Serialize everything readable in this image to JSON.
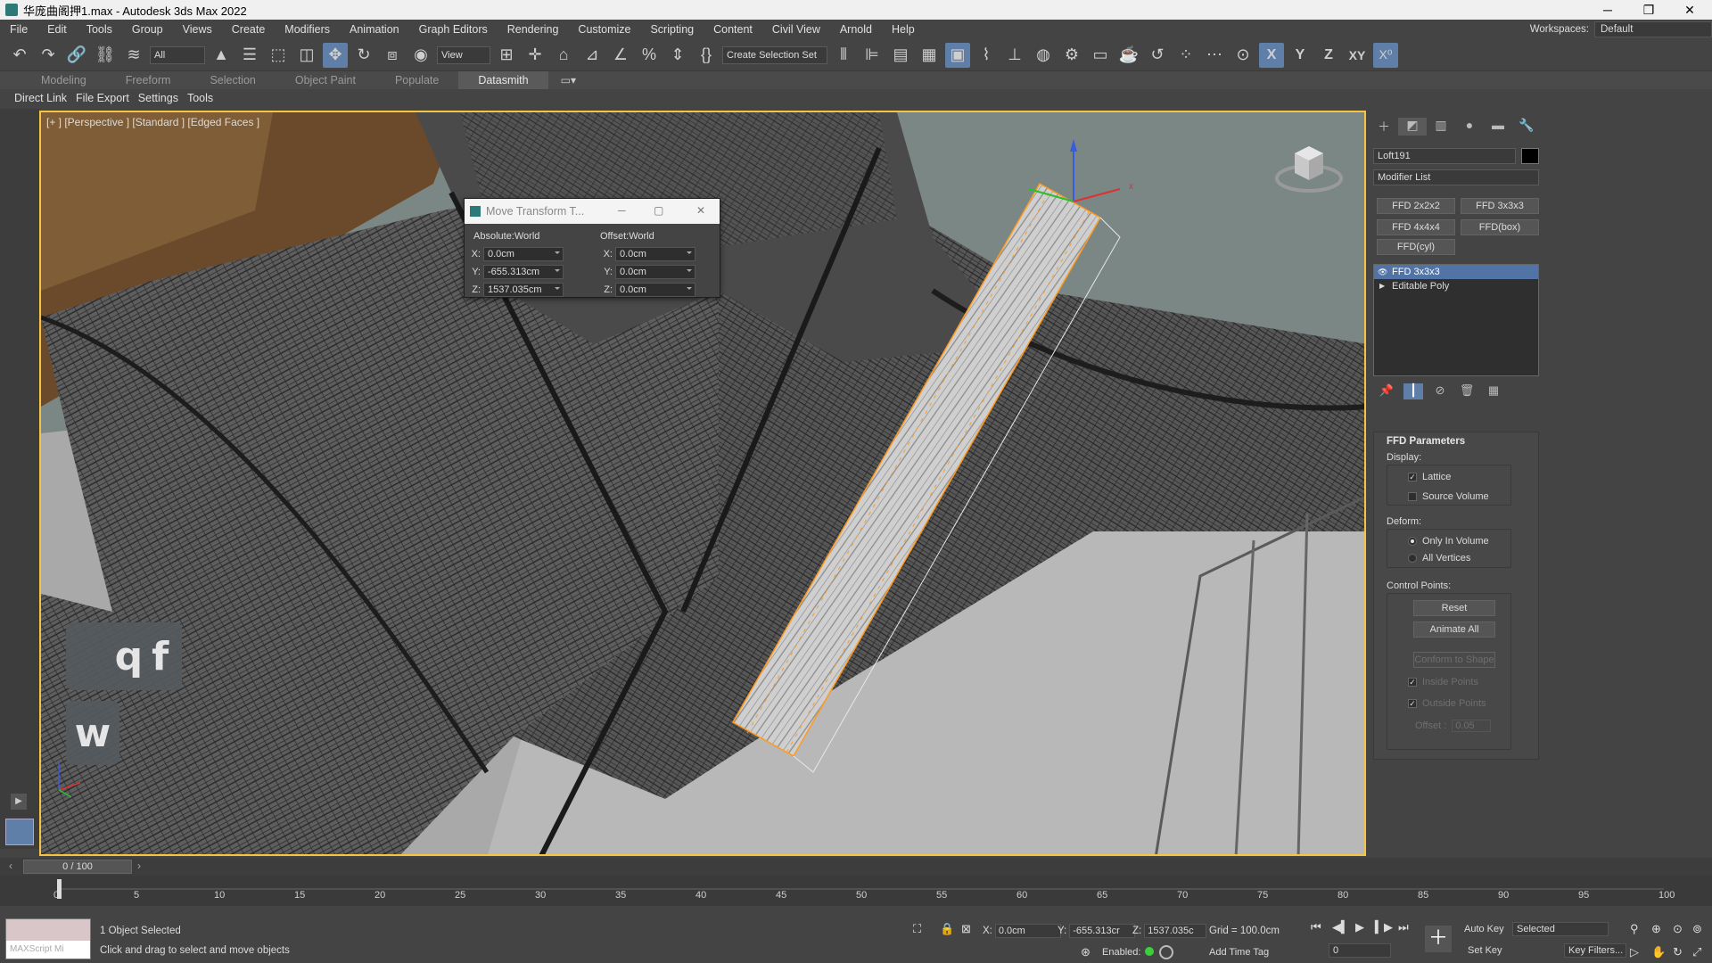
{
  "window": {
    "title": "华庞曲阁押1.max - Autodesk 3ds Max 2022"
  },
  "menu": [
    "File",
    "Edit",
    "Tools",
    "Group",
    "Views",
    "Create",
    "Modifiers",
    "Animation",
    "Graph Editors",
    "Rendering",
    "Customize",
    "Scripting",
    "Content",
    "Civil View",
    "Arnold",
    "Help"
  ],
  "workspaces": {
    "label": "Workspaces:",
    "value": "Default"
  },
  "toolbar": {
    "filter": "All",
    "refcoord": "View",
    "selset": "Create Selection Set",
    "axis_x": "X",
    "axis_y": "Y",
    "axis_z": "Z",
    "axis_xy": "XY"
  },
  "ribbon": {
    "tabs": [
      "Modeling",
      "Freeform",
      "Selection",
      "Object Paint",
      "Populate",
      "Datasmith"
    ],
    "active": "Datasmith"
  },
  "subbar": [
    "Direct Link",
    "File Export",
    "Settings",
    "Tools"
  ],
  "viewport": {
    "label": "[+ ] [Perspective ] [Standard ] [Edged Faces ]",
    "keys": [
      "q",
      "f",
      "w"
    ]
  },
  "dialog": {
    "title": "Move Transform T...",
    "absolute_label": "Absolute:World",
    "offset_label": "Offset:World",
    "abs": {
      "x": "0.0cm",
      "y": "-655.313cm",
      "z": "1537.035cm"
    },
    "off": {
      "x": "0.0cm",
      "y": "0.0cm",
      "z": "0.0cm"
    }
  },
  "command_panel": {
    "object_name": "Loft191",
    "modifier_list": "Modifier List",
    "mod_buttons": [
      "FFD 2x2x2",
      "FFD 3x3x3",
      "FFD 4x4x4",
      "FFD(box)",
      "FFD(cyl)"
    ],
    "stack": [
      "FFD 3x3x3",
      "Editable Poly"
    ],
    "ffd": {
      "title": "FFD Parameters",
      "display": "Display:",
      "lattice": "Lattice",
      "source_volume": "Source Volume",
      "deform": "Deform:",
      "only_in_volume": "Only In Volume",
      "all_vertices": "All Vertices",
      "control_points": "Control Points:",
      "reset": "Reset",
      "animate_all": "Animate All",
      "conform": "Conform to Shape",
      "inside_points": "Inside Points",
      "outside_points": "Outside Points",
      "offset_label": "Offset :",
      "offset_value": "0.05"
    }
  },
  "timeline": {
    "slider": "0 / 100",
    "ticks": [
      "0",
      "5",
      "10",
      "15",
      "20",
      "25",
      "30",
      "35",
      "40",
      "45",
      "50",
      "55",
      "60",
      "65",
      "70",
      "75",
      "80",
      "85",
      "90",
      "95",
      "100"
    ]
  },
  "status": {
    "maxscript": "MAXScript Mi",
    "selected": "1 Object Selected",
    "prompt": "Click and drag to select and move objects",
    "x": "0.0cm",
    "y": "-655.313cr",
    "z": "1537.035c",
    "grid": "Grid = 100.0cm",
    "enabled": "Enabled:",
    "add_time_tag": "Add Time Tag",
    "auto_key": "Auto Key",
    "set_key": "Set Key",
    "selected_dd": "Selected",
    "key_filters": "Key Filters...",
    "frame": "0"
  },
  "colors": {
    "accent": "#5f7ea8",
    "viewport_border": "#f5c542",
    "selection": "#ff9a1f"
  }
}
